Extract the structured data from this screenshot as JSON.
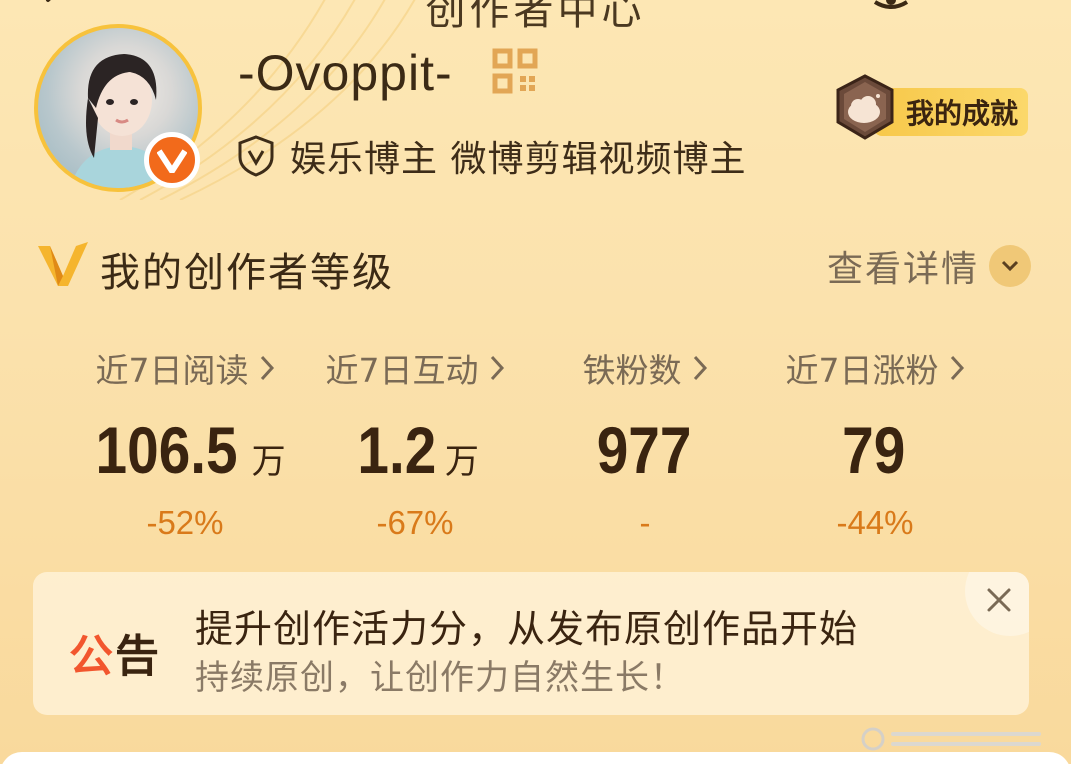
{
  "header": {
    "title": "创作者中心"
  },
  "profile": {
    "username": "-Ovoppit-",
    "certification": "娱乐博主 微博剪辑视频博主",
    "achievement_label": "我的成就"
  },
  "level": {
    "title": "我的创作者等级",
    "detail_label": "查看详情"
  },
  "stats": [
    {
      "label": "近7日阅读",
      "value": "106.5",
      "unit": "万",
      "change": "-52%"
    },
    {
      "label": "近7日互动",
      "value": "1.2",
      "unit": "万",
      "change": "-67%"
    },
    {
      "label": "铁粉数",
      "value": "977",
      "unit": "",
      "change": "-"
    },
    {
      "label": "近7日涨粉",
      "value": "79",
      "unit": "",
      "change": "-44%"
    }
  ],
  "notice": {
    "tag_part1": "公",
    "tag_part2": "告",
    "title": "提升创作活力分，从发布原创作品开始",
    "subtitle": "持续原创，让创作力自然生长！"
  },
  "colors": {
    "accent_orange": "#f26a1b",
    "change_text": "#d97a1a",
    "badge_gold": "#f7c84a"
  }
}
